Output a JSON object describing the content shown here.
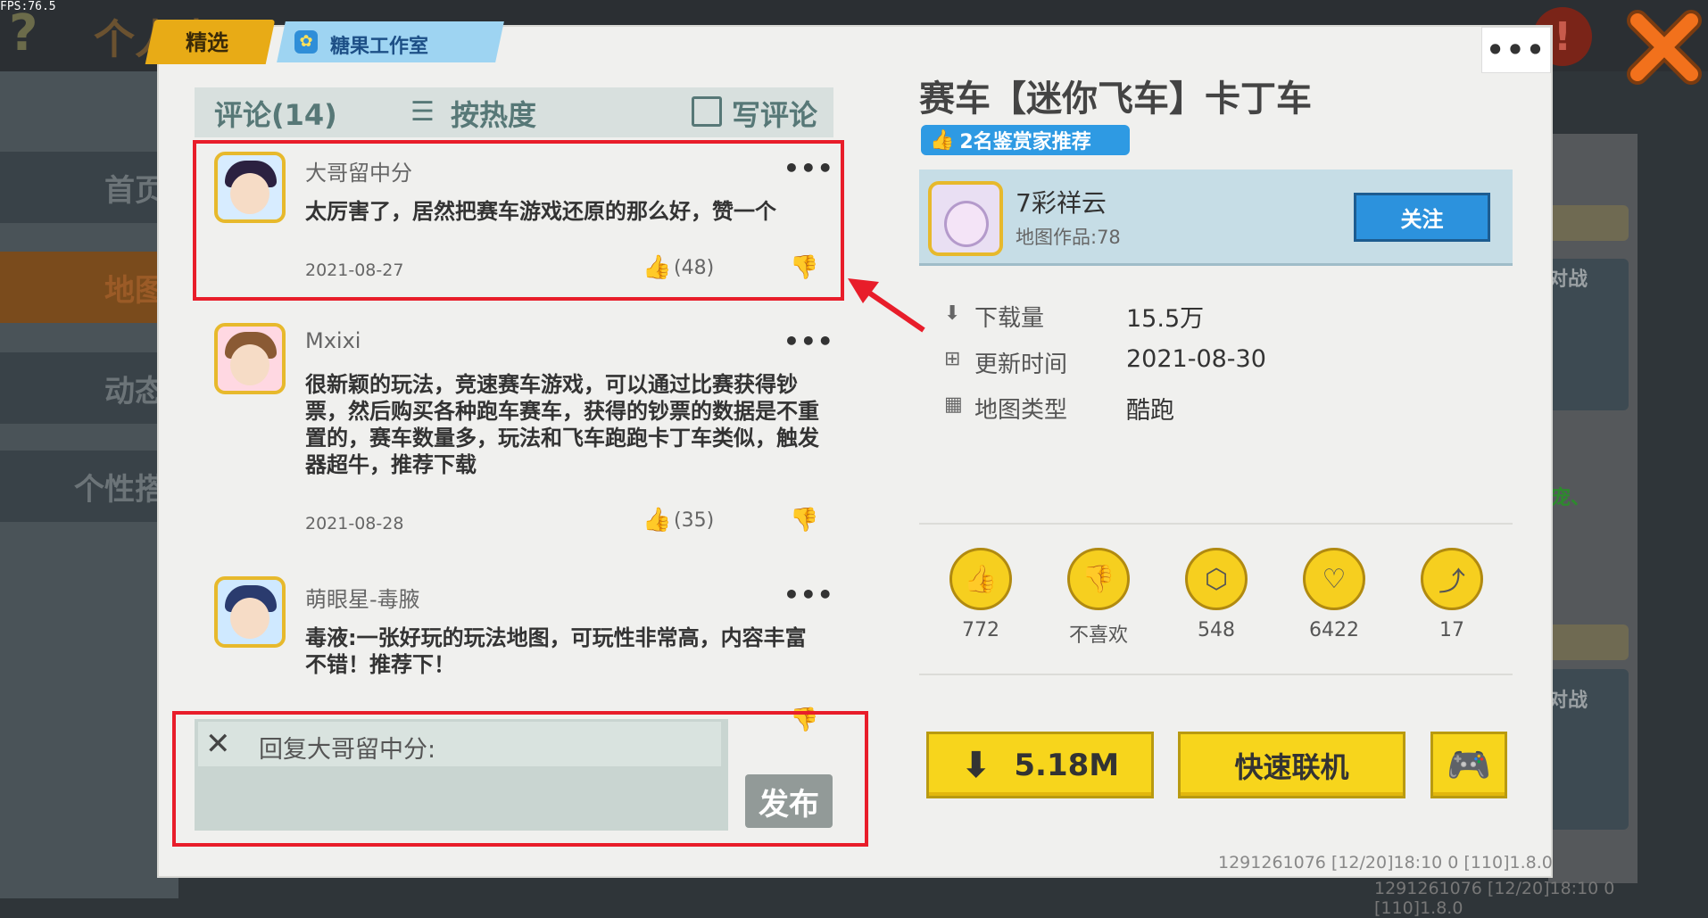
{
  "fps": "FPS:76.5",
  "background": {
    "title": "个人中心",
    "sidebar": [
      "首页",
      "地图",
      "动态",
      "个性搭"
    ],
    "right_labels": [
      "对战",
      "宠、",
      "对战"
    ],
    "footer_version": "1291261076  [12/20]18:10 0  [110]1.8.0"
  },
  "tabs": {
    "featured": "精选",
    "studio": "糖果工作室"
  },
  "more_label": "•••",
  "comments": {
    "title": "评论(14)",
    "sort_label": "按热度",
    "write_label": "写评论",
    "items": [
      {
        "name": "大哥留中分",
        "text": "太厉害了，居然把赛车游戏还原的那么好，赞一个",
        "date": "2021-08-27",
        "likes": "(48)"
      },
      {
        "name": "Mxixi",
        "text": "很新颖的玩法，竞速赛车游戏，可以通过比赛获得钞票，然后购买各种跑车赛车，获得的钞票的数据是不重置的，赛车数量多，玩法和飞车跑跑卡丁车类似，触发器超牛，推荐下载",
        "date": "2021-08-28",
        "likes": "(35)"
      },
      {
        "name": "萌眼星-毒腋",
        "text": "毒液:一张好玩的玩法地图，可玩性非常高，内容丰富不错！推荐下！",
        "date": "",
        "likes": ""
      }
    ]
  },
  "reply": {
    "label": "回复大哥留中分:",
    "publish": "发布"
  },
  "map": {
    "title": "赛车【迷你飞车】卡丁车",
    "recommend_badge": "2名鉴赏家推荐",
    "author_name": "7彩祥云",
    "author_works": "地图作品:78",
    "follow": "关注",
    "info": [
      {
        "label": "下载量",
        "value": "15.5万"
      },
      {
        "label": "更新时间",
        "value": "2021-08-30"
      },
      {
        "label": "地图类型",
        "value": "酷跑"
      }
    ],
    "stats": [
      {
        "label": "772"
      },
      {
        "label": "不喜欢"
      },
      {
        "label": "548"
      },
      {
        "label": "6422"
      },
      {
        "label": "17"
      }
    ],
    "download_size": "5.18M",
    "quick_connect": "快速联机"
  },
  "footer_version": "1291261076  [12/20]18:10 0  [110]1.8.0",
  "colors": {
    "highlight_red": "#e81d2a",
    "accent_yellow": "#f7d51c",
    "accent_blue": "#2c92dd"
  }
}
